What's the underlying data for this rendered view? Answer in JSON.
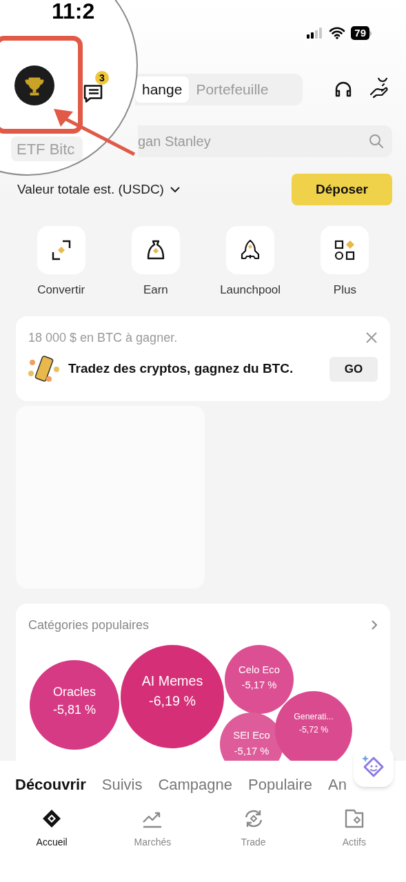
{
  "status_bar": {
    "time": "11:2",
    "battery": "79"
  },
  "header": {
    "notification_count": "3",
    "tabs": [
      {
        "label": "hange",
        "selected": true
      },
      {
        "label": "Portefeuille",
        "selected": false
      }
    ]
  },
  "magnifier": {
    "field_text": "ETF Bitc"
  },
  "search": {
    "placeholder": "gan Stanley"
  },
  "balance": {
    "label": "Valeur totale est. (USDC)",
    "deposit_button": "Déposer"
  },
  "shortcuts": [
    {
      "kind": "convert",
      "label": "Convertir"
    },
    {
      "kind": "earn",
      "label": "Earn"
    },
    {
      "kind": "launchpool",
      "label": "Launchpool"
    },
    {
      "kind": "more",
      "label": "Plus"
    }
  ],
  "promo": {
    "headline": "18 000 $ en BTC à gagner.",
    "text": "Tradez des cryptos, gagnez du BTC.",
    "button": "GO"
  },
  "categories": {
    "title": "Catégories populaires",
    "bubbles": [
      {
        "name": "Oracles",
        "change": "-5,81 %",
        "color": "#d63a84"
      },
      {
        "name": "AI Memes",
        "change": "-6,19 %",
        "color": "#d42f77"
      },
      {
        "name": "Celo Eco",
        "change": "-5,17 %",
        "color": "#dc4f93"
      },
      {
        "name": "SEI Eco",
        "change": "-5,17 %",
        "color": "#de5c9a"
      },
      {
        "name": "Generati...",
        "change": "-5,72 %",
        "color": "#da4a8f"
      }
    ]
  },
  "feed_tabs": [
    {
      "label": "Découvrir",
      "selected": true
    },
    {
      "label": "Suivis",
      "selected": false
    },
    {
      "label": "Campagne",
      "selected": false
    },
    {
      "label": "Populaire",
      "selected": false
    },
    {
      "label": "An",
      "selected": false
    }
  ],
  "bottom_nav": [
    {
      "kind": "home",
      "label": "Accueil",
      "selected": true
    },
    {
      "kind": "markets",
      "label": "Marchés",
      "selected": false
    },
    {
      "kind": "trade",
      "label": "Trade",
      "selected": false
    },
    {
      "kind": "assets",
      "label": "Actifs",
      "selected": false
    }
  ]
}
